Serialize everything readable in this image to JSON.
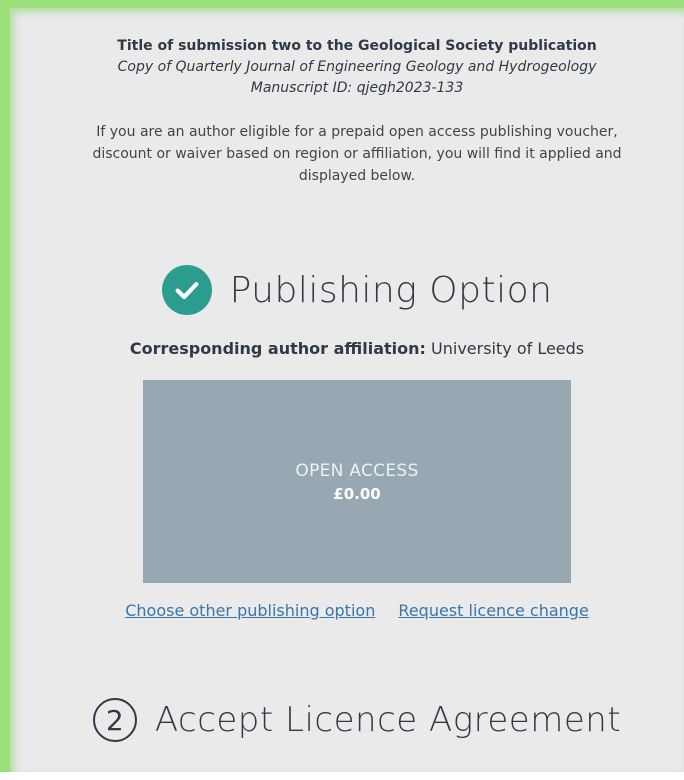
{
  "submission": {
    "title": "Title of submission two to the Geological Society publication",
    "journal": "Copy of Quarterly Journal of Engineering Geology and Hydrogeology",
    "manuscript_id": "Manuscript ID: qjegh2023-133"
  },
  "voucher_notice": "If you are an author eligible for a prepaid open access publishing voucher, discount or waiver based on region or affiliation, you will find it applied and displayed below.",
  "publishing_option": {
    "heading": "Publishing Option",
    "status_icon": "check-circle-icon",
    "affiliation_label": "Corresponding author affiliation:",
    "affiliation_value": "University of Leeds",
    "option_name": "OPEN ACCESS",
    "option_price": "£0.00",
    "links": {
      "choose_other": "Choose other publishing option",
      "request_change": "Request licence change"
    }
  },
  "licence_step": {
    "number": "2",
    "heading": "Accept Licence Agreement"
  },
  "colors": {
    "frame_border": "#9be07a",
    "background": "#eaeaea",
    "check_circle": "#2a9d8f",
    "option_box": "#97a8b3",
    "link": "#3a76a8"
  }
}
